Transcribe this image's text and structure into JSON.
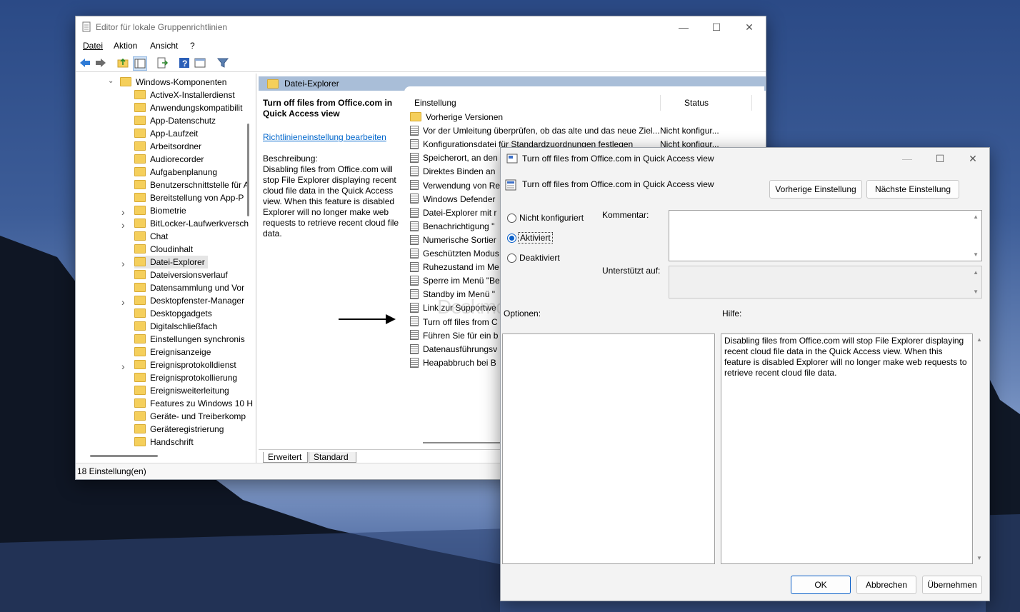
{
  "editor": {
    "title": "Editor für lokale Gruppenrichtlinien",
    "menu": [
      "Datei",
      "Aktion",
      "Ansicht",
      "?"
    ],
    "tree_root": "Windows-Komponenten",
    "tree_items": [
      "ActiveX-Installerdienst",
      "Anwendungskompatibilit",
      "App-Datenschutz",
      "App-Laufzeit",
      "Arbeitsordner",
      "Audiorecorder",
      "Aufgabenplanung",
      "Benutzerschnittstelle für A",
      "Bereitstellung von App-P",
      "Biometrie",
      "BitLocker-Laufwerkversch",
      "Chat",
      "Cloudinhalt",
      "Datei-Explorer",
      "Dateiversionsverlauf",
      "Datensammlung und Vor",
      "Desktopfenster-Manager",
      "Desktopgadgets",
      "Digitalschließfach",
      "Einstellungen synchronis",
      "Ereignisanzeige",
      "Ereignisprotokolldienst",
      "Ereignisprotokollierung",
      "Ereignisweiterleitung",
      "Features zu Windows 10 H",
      "Geräte- und Treiberkomp",
      "Geräteregistrierung",
      "Handschrift"
    ],
    "expandable_indices": [
      9,
      10,
      13,
      16,
      21
    ],
    "selected_index": 13,
    "header": "Datei-Explorer",
    "desc_title": "Turn off files from Office.com in Quick Access view",
    "desc_link": "Richtlinieneinstellung bearbeiten",
    "desc_label": "Beschreibung:",
    "desc_text": "Disabling files from Office.com will stop File Explorer displaying recent cloud file data in the Quick Access view. When this feature is disabled Explorer will no longer make web requests to retrieve recent cloud file data.",
    "col_setting": "Einstellung",
    "col_status": "Status",
    "rows": [
      {
        "name": "Vorherige Versionen",
        "status": "",
        "folder": true
      },
      {
        "name": "Vor der Umleitung überprüfen, ob das alte und das neue Ziel...",
        "status": "Nicht konfigur..."
      },
      {
        "name": "Konfigurationsdatei für Standardzuordnungen festlegen",
        "status": "Nicht konfigur..."
      },
      {
        "name": "Speicherort, an den",
        "status": ""
      },
      {
        "name": "Direktes Binden an",
        "status": ""
      },
      {
        "name": "Verwendung von Re",
        "status": ""
      },
      {
        "name": "Windows Defender",
        "status": ""
      },
      {
        "name": "Datei-Explorer mit r",
        "status": ""
      },
      {
        "name": "Benachrichtigung \"",
        "status": ""
      },
      {
        "name": "Numerische Sortier",
        "status": ""
      },
      {
        "name": "Geschützten Modus",
        "status": ""
      },
      {
        "name": "Ruhezustand im Me",
        "status": ""
      },
      {
        "name": "Sperre im Menü \"Be",
        "status": ""
      },
      {
        "name": "Standby im Menü \"",
        "status": ""
      },
      {
        "name": "Link zur Supportwe",
        "status": ""
      },
      {
        "name": "Turn off files from C",
        "status": ""
      },
      {
        "name": "Führen Sie für ein b",
        "status": ""
      },
      {
        "name": "Datenausführungsv",
        "status": ""
      },
      {
        "name": "Heapabbruch bei B",
        "status": ""
      }
    ],
    "tabs": [
      "Erweitert",
      "Standard"
    ],
    "status_bar": "18 Einstellung(en)"
  },
  "dialog": {
    "title": "Turn off files from Office.com in Quick Access view",
    "policy_name": "Turn off files from Office.com in Quick Access view",
    "prev_button": "Vorherige Einstellung",
    "next_button": "Nächste Einstellung",
    "radio_not_configured": "Nicht konfiguriert",
    "radio_enabled": "Aktiviert",
    "radio_disabled": "Deaktiviert",
    "selected_option": "Aktiviert",
    "comment_label": "Kommentar:",
    "supported_label": "Unterstützt auf:",
    "options_label": "Optionen:",
    "help_label": "Hilfe:",
    "help_text": "Disabling files from Office.com will stop File Explorer displaying recent cloud file data in the Quick Access view. When this feature is disabled Explorer will no longer make web requests to retrieve recent cloud file data.",
    "ok": "OK",
    "cancel": "Abbrechen",
    "apply": "Übernehmen"
  },
  "watermark": "Deskmodder.de",
  "colors": {
    "accent": "#0a5fc8",
    "header_bg": "#a9bed8",
    "link": "#0066cc"
  }
}
